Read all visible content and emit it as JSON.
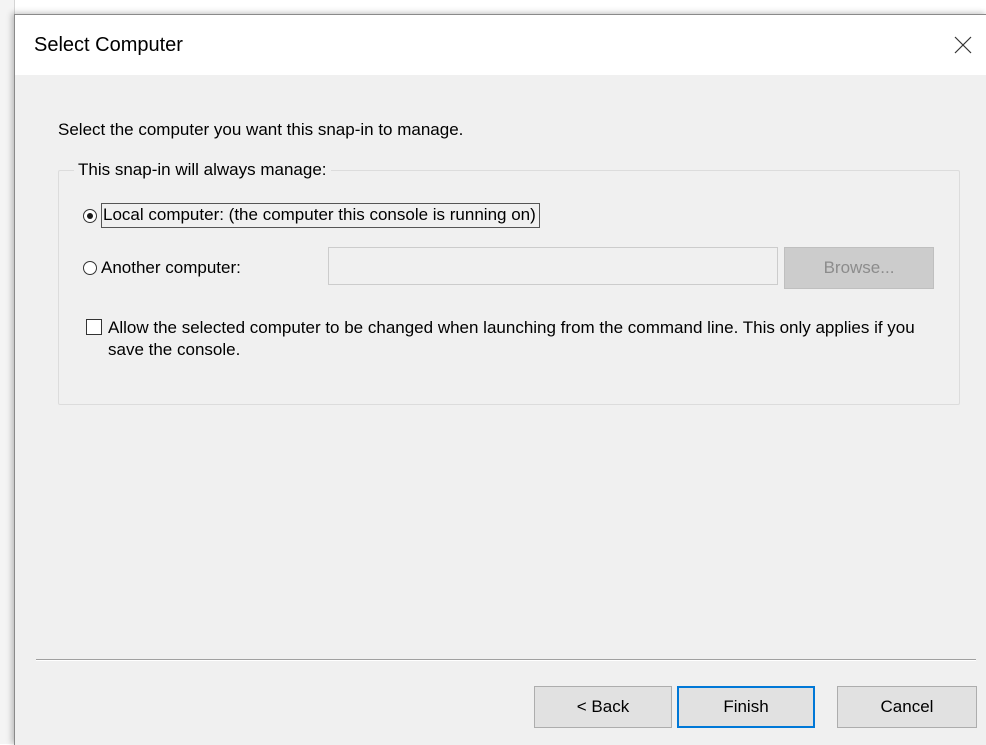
{
  "dialog": {
    "title": "Select Computer",
    "close_icon": "close-icon",
    "instruction": "Select the computer you want this snap-in to manage.",
    "group_label": "This snap-in will always manage:",
    "options": {
      "local": {
        "label": "Local computer:  (the computer this console is running on)",
        "checked": true
      },
      "another": {
        "label": "Another computer:",
        "checked": false,
        "input_value": "",
        "browse_label": "Browse..."
      }
    },
    "allow_change": {
      "label": "Allow the selected computer to be changed when launching from the command line.  This only applies if you save the console.",
      "checked": false
    },
    "buttons": {
      "back": "< Back",
      "finish": "Finish",
      "cancel": "Cancel"
    },
    "colors": {
      "default_button_border": "#0078d7",
      "dialog_bg": "#f0f0f0"
    }
  }
}
